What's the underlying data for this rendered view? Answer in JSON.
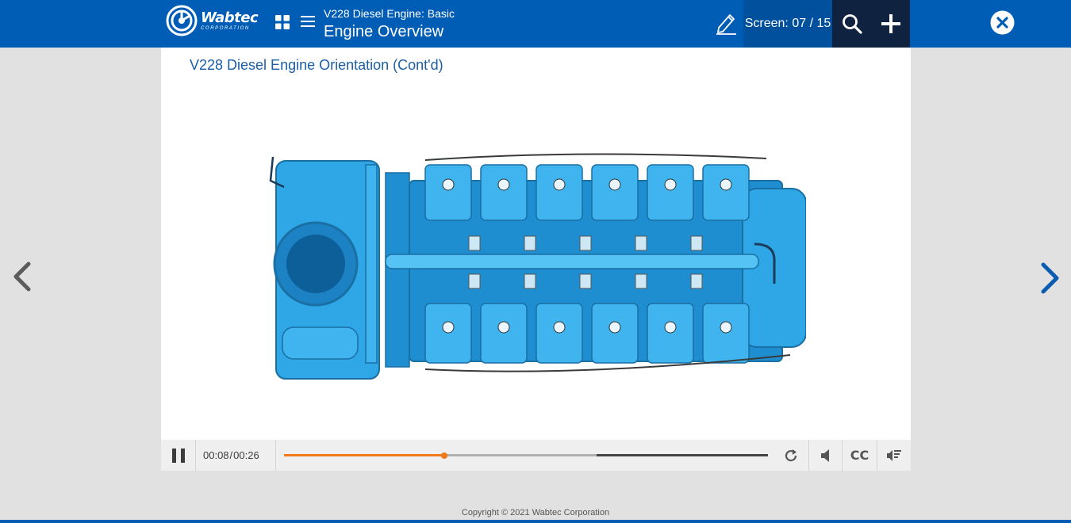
{
  "header": {
    "logo": {
      "name": "Wabtec",
      "subtitle": "CORPORATION"
    },
    "course_title": "V228 Diesel Engine: Basic",
    "module_title": "Engine Overview",
    "screen_counter": "Screen: 07 / 15",
    "icons": {
      "tiles": "grid-icon",
      "menu": "hamburger-icon",
      "notes": "pencil-icon",
      "search": "search-icon",
      "add": "plus-icon",
      "close": "close-circle-icon"
    },
    "colors": {
      "bar": "#005db6",
      "screen_box": "#00509e",
      "dark_buttons": "#0f2240"
    }
  },
  "content": {
    "title": "V228 Diesel Engine Orientation (Cont'd)",
    "image": "v228-diesel-engine-top-view",
    "engine_color": "#2fa6e6"
  },
  "navigation": {
    "prev": "chevron-left-icon",
    "next": "chevron-right-icon"
  },
  "player": {
    "current_time": "00:08",
    "separator": "/",
    "duration": "00:26",
    "progress_fraction": 0.331,
    "buffered_fraction": 0.646,
    "progress_color": "#f07a19",
    "cc_label": "CC",
    "icons": {
      "pause": "pause-icon",
      "replay": "replay-icon",
      "volume": "volume-icon",
      "transcript": "transcript-icon"
    }
  },
  "footer": {
    "copyright": "Copyright © 2021 Wabtec Corporation"
  }
}
